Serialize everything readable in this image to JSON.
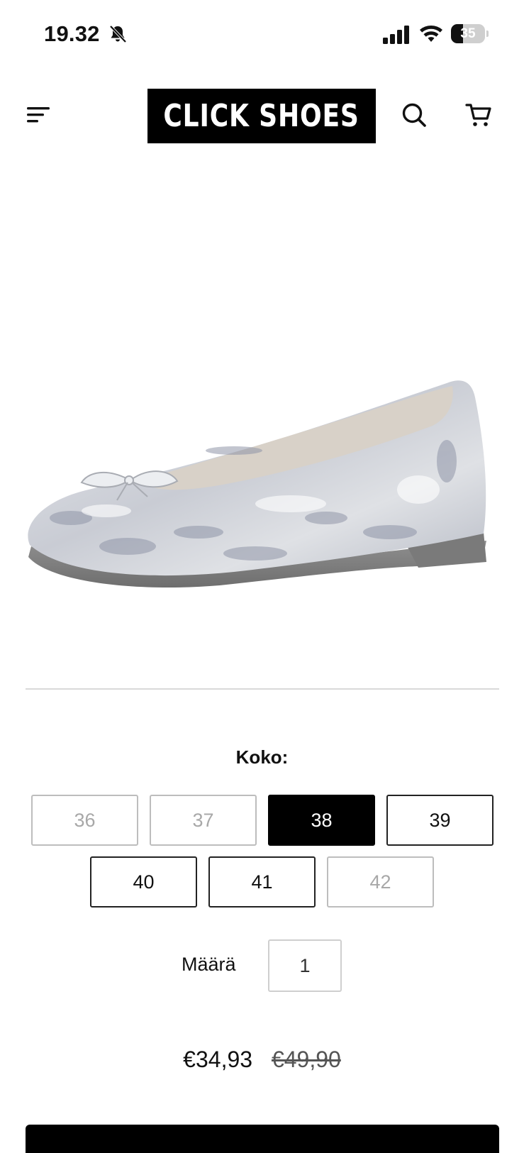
{
  "status_bar": {
    "time": "19.32",
    "battery_level": "35",
    "battery_fraction": 0.35,
    "icons": [
      "bell-muted-icon",
      "signal-icon",
      "wifi-icon",
      "battery-icon"
    ]
  },
  "header": {
    "logo_text": "CLICK SHOES",
    "icons": [
      "menu-icon",
      "search-icon",
      "cart-icon"
    ]
  },
  "product": {
    "image_alt": "Silver metallic ballet flat with bow"
  },
  "size": {
    "label": "Koko:",
    "options": [
      {
        "value": "36",
        "state": "unavailable"
      },
      {
        "value": "37",
        "state": "unavailable"
      },
      {
        "value": "38",
        "state": "selected"
      },
      {
        "value": "39",
        "state": "available"
      },
      {
        "value": "40",
        "state": "available"
      },
      {
        "value": "41",
        "state": "available"
      },
      {
        "value": "42",
        "state": "unavailable"
      }
    ]
  },
  "quantity": {
    "label": "Määrä",
    "value": "1"
  },
  "price": {
    "current": "€34,93",
    "original": "€49,90"
  },
  "colors": {
    "accent": "#000000",
    "disabled_border": "#bdbdbd",
    "disabled_text": "#a8a8a8"
  }
}
